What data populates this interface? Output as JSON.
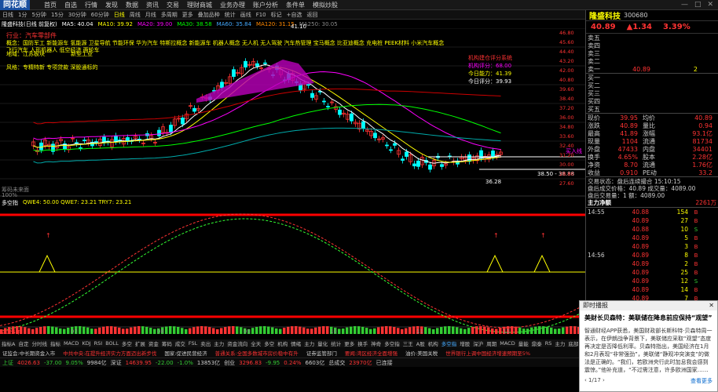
{
  "app": {
    "logo": "同花顺",
    "menu": [
      "首页",
      "自选",
      "行情",
      "发现",
      "数据",
      "资讯",
      "交易",
      "理财商城",
      "业务办理",
      "账户分析",
      "条件单",
      "模拟炒股"
    ],
    "window_controls": [
      "—",
      "□",
      "✕"
    ]
  },
  "toolbar": {
    "items": [
      "日线",
      "1分",
      "5分钟",
      "15分",
      "30分钟",
      "60分钟",
      "日线",
      "周线",
      "月线",
      "多周期",
      "更多",
      "叠加品种",
      "统计",
      "画线",
      "F10",
      "标记",
      "+自选",
      "返回"
    ],
    "selected": "日线"
  },
  "infoline": {
    "stock": "隆盛科技(日线 前复权)",
    "ma": [
      "MA5: 40.04",
      "MA10: 39.92",
      "MA20: 39.00",
      "MA30: 38.58",
      "MA60: 35.84",
      "MA120: 31.15",
      "MA250: 30.05"
    ]
  },
  "chart_labels": {
    "concept_header": "行业：汽车零部件",
    "concepts_line1": "概念：国防军工 新能源车 氢能源 卫星导航 节能环保 华为汽车 特斯拉概念 新能源车 机器人概念 无人机 无人驾驶 汽车热管理 宝马概念 比亚迪概念 充电桩 PEEK材料 小米汽车概念 飞行汽车 人形机器人 低空经济 两轮车",
    "concepts_line2": "地域：江苏板块",
    "concepts_line3": "风格：专精特新 专项贷款 深股通标的",
    "special": "新型工业",
    "score_title": "机构建仓评分系统",
    "score1": "机构评分：68.00",
    "score2": "今日能力：41.39",
    "score3": "今日评分：39.93",
    "peak": "41.10",
    "low1": "36.28",
    "low2": "38.50 - 38.88",
    "mark_right": "买入线",
    "volume_label": "筹码未来面",
    "volume_sub": "100%",
    "indicator_title": "多空指",
    "indicator_values": "QWE4: 50.00 QWE7: 23.21 TRY7: 23.21"
  },
  "axis": {
    "price_ticks": [
      "46.80",
      "45.60",
      "44.40",
      "43.20",
      "42.00",
      "40.80",
      "39.60",
      "38.40",
      "37.20",
      "36.00",
      "34.80",
      "33.60",
      "32.40",
      "31.20",
      "30.00",
      "28.80",
      "27.60"
    ],
    "date_label": "2025年",
    "date_ticks": [
      "07",
      "08",
      "09",
      "10",
      "11",
      "12"
    ]
  },
  "quote": {
    "name": "隆盛科技",
    "code": "300680",
    "price": "40.89",
    "change": "1.34",
    "pct": "3.39%"
  },
  "orderbook": {
    "asks": [
      {
        "l": "卖五",
        "p": "",
        "v": ""
      },
      {
        "l": "卖四",
        "p": "",
        "v": ""
      },
      {
        "l": "卖三",
        "p": "",
        "v": ""
      },
      {
        "l": "卖二",
        "p": "",
        "v": ""
      },
      {
        "l": "卖一",
        "p": "40.89",
        "v": "2"
      }
    ],
    "bids": [
      {
        "l": "买一",
        "p": "",
        "v": ""
      },
      {
        "l": "买二",
        "p": "",
        "v": ""
      },
      {
        "l": "买三",
        "p": "",
        "v": ""
      },
      {
        "l": "买四",
        "p": "",
        "v": ""
      },
      {
        "l": "买五",
        "p": "",
        "v": ""
      }
    ]
  },
  "stats": [
    {
      "a": "现价",
      "b": "39.95",
      "c": "均价",
      "d": "40.89"
    },
    {
      "a": "涨跌",
      "b": "40.89",
      "c": "量比",
      "d": "0.94"
    },
    {
      "a": "最高",
      "b": "41.89",
      "c": "涨幅",
      "d": "93.1亿"
    },
    {
      "a": "现量",
      "b": "1104",
      "c": "流通",
      "d": "81734"
    },
    {
      "a": "外盘",
      "b": "47433",
      "c": "内盘",
      "d": "34401"
    },
    {
      "a": "换手",
      "b": "4.65%",
      "c": "股本",
      "d": "2.28亿"
    },
    {
      "a": "净资",
      "b": "8.70",
      "c": "流通",
      "d": "1.76亿"
    },
    {
      "a": "收益",
      "b": "0.910",
      "c": "PE动",
      "d": "33.2"
    }
  ],
  "trade_status": {
    "line1": "交易状态：盘后连续撮合 15:10:15",
    "line2": "盘后成交价格：40.89 成交量：4089.00",
    "line3": "盘后交易量：1 额：4089.00",
    "line4": "主力净额",
    "line4v": "2261万"
  },
  "ticks": [
    {
      "t": "14:55",
      "p": "40.88",
      "v": "154",
      "s": "B"
    },
    {
      "t": "",
      "p": "40.89",
      "v": "27",
      "s": "B"
    },
    {
      "t": "",
      "p": "40.88",
      "v": "10",
      "s": "S"
    },
    {
      "t": "",
      "p": "40.89",
      "v": "5",
      "s": "B"
    },
    {
      "t": "",
      "p": "40.89",
      "v": "3",
      "s": "B"
    },
    {
      "t": "14:56",
      "p": "40.89",
      "v": "8",
      "s": "B"
    },
    {
      "t": "",
      "p": "40.89",
      "v": "2",
      "s": "B"
    },
    {
      "t": "",
      "p": "40.89",
      "v": "25",
      "s": "B"
    },
    {
      "t": "",
      "p": "40.89",
      "v": "12",
      "s": "S"
    },
    {
      "t": "",
      "p": "40.89",
      "v": "14",
      "s": "B"
    },
    {
      "t": "",
      "p": "40.89",
      "v": "7",
      "s": "B"
    },
    {
      "t": "",
      "p": "40.89",
      "v": "1",
      "s": "B"
    },
    {
      "t": "",
      "p": "40.89",
      "v": "6",
      "s": "B"
    },
    {
      "t": "",
      "p": "40.89",
      "v": "9",
      "s": "S"
    },
    {
      "t": "",
      "p": "40.89",
      "v": "4",
      "s": "B"
    },
    {
      "t": "",
      "p": "40.89",
      "v": "3",
      "s": "B"
    }
  ],
  "news": {
    "header": "即时播报",
    "close": "✕",
    "title": "美财长贝森特：美联储在降息前应保持“观望”",
    "body": "智通财经APP获悉，美国财政部长斯科特·贝森特周一表示，在伊朗战争背景下，美联储应采取“观望”态度再决定是否降低利率。贝森特指出，美国经济在1月和2月表现“非常强劲”，美联储“静观冲突演变”的做法是正确的。“我们，若欧洲央行此时加息我会感到震惊。”他补充道，“不过需注意，许多欧洲国家……",
    "page": "1/17",
    "more": "查看更多"
  },
  "bottom_tabs": [
    "指标A",
    "自定",
    "分时线",
    "指标",
    "MACD",
    "KDJ",
    "RSI",
    "BOLL",
    "多空",
    "扩展",
    "资金",
    "筹码",
    "成交",
    "FSL",
    "卖出",
    "主力",
    "资金流向",
    "全天",
    "多空",
    "机构",
    "情绪",
    "主力",
    "量化",
    "统计",
    "更多",
    "换手",
    "神奇",
    "多空指",
    "三王",
    "A股",
    "机构",
    "多空指",
    "增股",
    "深沪",
    "周期",
    "MACD",
    "量能",
    "鼎泰",
    "RS",
    "主力",
    "底部",
    "多空",
    "中长",
    "资金",
    "顶部",
    "指标E"
  ],
  "bottom_selected": "多空指",
  "ticker": [
    "证监会:中长期资金入市",
    "中共中央:在提升经济实力方面迈出新步伐",
    "国家:促进民营经济",
    "普通关系:全国多数城市房价稳中有升",
    "证券监管部门",
    "要闻:湾区经济全面增强",
    "油价:美国关税",
    "世界银行上调中国经济增速预期至5%"
  ],
  "status": {
    "items": [
      {
        "t": "上证",
        "c": "grn"
      },
      {
        "t": "4026.63",
        "c": "red"
      },
      {
        "t": "-37.00",
        "c": "grn"
      },
      {
        "t": "9.05%",
        "c": "grn"
      },
      {
        "t": "9984亿",
        "c": "w"
      },
      {
        "t": "深证",
        "c": "w"
      },
      {
        "t": "14639.95",
        "c": "red"
      },
      {
        "t": "-22.00",
        "c": "grn"
      },
      {
        "t": "-1.0%",
        "c": "grn"
      },
      {
        "t": "13853亿",
        "c": "w"
      },
      {
        "t": "创业",
        "c": "w"
      },
      {
        "t": "3296.83",
        "c": "red"
      },
      {
        "t": "-9.95",
        "c": "grn"
      },
      {
        "t": "0.24%",
        "c": "red"
      },
      {
        "t": "6603亿",
        "c": "w"
      },
      {
        "t": "总成交",
        "c": "w"
      },
      {
        "t": "23970亿",
        "c": "red"
      },
      {
        "t": "已连接",
        "c": "w"
      }
    ]
  },
  "colors": {
    "up": "#ff3333",
    "down": "#33cc33",
    "accent": "#ffff00",
    "bg": "#000000"
  }
}
